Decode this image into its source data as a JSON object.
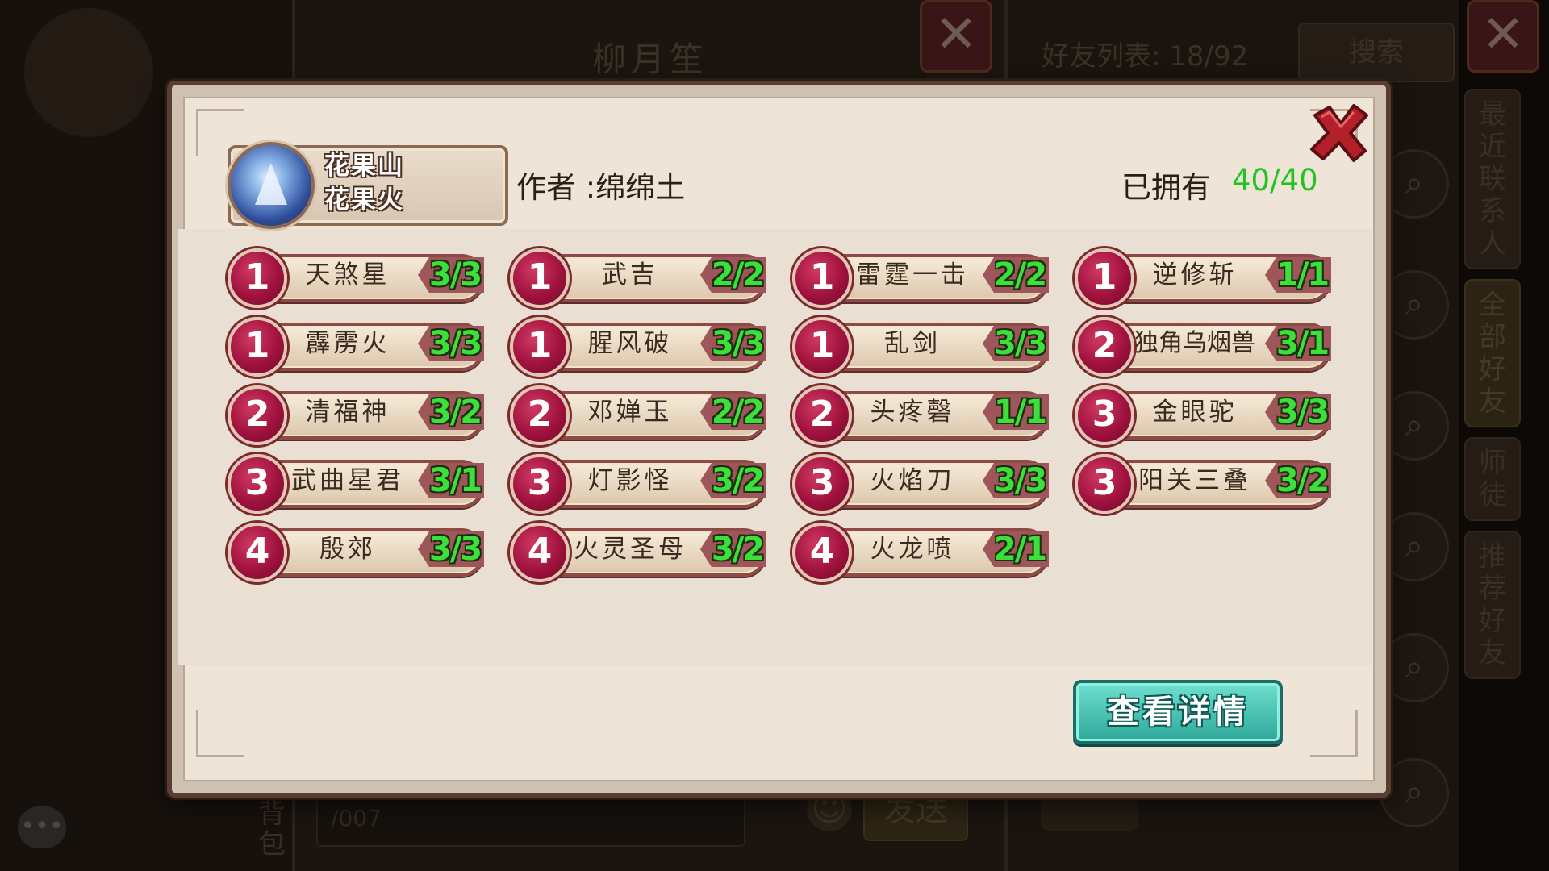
{
  "background": {
    "chat_title": "柳月笙",
    "friends_title": "好友列表: 18/92",
    "search_label": "搜索",
    "tabs": [
      "最近联系人",
      "全部好友",
      "师徒",
      "推荐好友"
    ],
    "input_value": "/007",
    "send_label": "发送",
    "bag_label": "背包"
  },
  "modal": {
    "set_name_line1": "花果山",
    "set_name_line2": "花果火",
    "author": "作者 :绵绵土",
    "owned_label": "已拥有",
    "owned_value": "40/40",
    "details_button": "查看详情",
    "close_icon": "close-x-icon",
    "accent_green": "#22c51e",
    "cards": [
      {
        "cost": "1",
        "name": "天煞星",
        "count": "3/3"
      },
      {
        "cost": "1",
        "name": "武吉",
        "count": "2/2"
      },
      {
        "cost": "1",
        "name": "雷霆一击",
        "count": "2/2"
      },
      {
        "cost": "1",
        "name": "逆修斩",
        "count": "1/1"
      },
      {
        "cost": "1",
        "name": "霹雳火",
        "count": "3/3"
      },
      {
        "cost": "1",
        "name": "腥风破",
        "count": "3/3"
      },
      {
        "cost": "1",
        "name": "乱剑",
        "count": "3/3"
      },
      {
        "cost": "2",
        "name": "独角乌烟兽",
        "count": "3/1"
      },
      {
        "cost": "2",
        "name": "清福神",
        "count": "3/2"
      },
      {
        "cost": "2",
        "name": "邓婵玉",
        "count": "2/2"
      },
      {
        "cost": "2",
        "name": "头疼磬",
        "count": "1/1"
      },
      {
        "cost": "3",
        "name": "金眼驼",
        "count": "3/3"
      },
      {
        "cost": "3",
        "name": "武曲星君",
        "count": "3/1"
      },
      {
        "cost": "3",
        "name": "灯影怪",
        "count": "3/2"
      },
      {
        "cost": "3",
        "name": "火焰刀",
        "count": "3/3"
      },
      {
        "cost": "3",
        "name": "阳关三叠",
        "count": "3/2"
      },
      {
        "cost": "4",
        "name": "殷郊",
        "count": "3/3"
      },
      {
        "cost": "4",
        "name": "火灵圣母",
        "count": "3/2"
      },
      {
        "cost": "4",
        "name": "火龙喷",
        "count": "2/1"
      }
    ]
  }
}
